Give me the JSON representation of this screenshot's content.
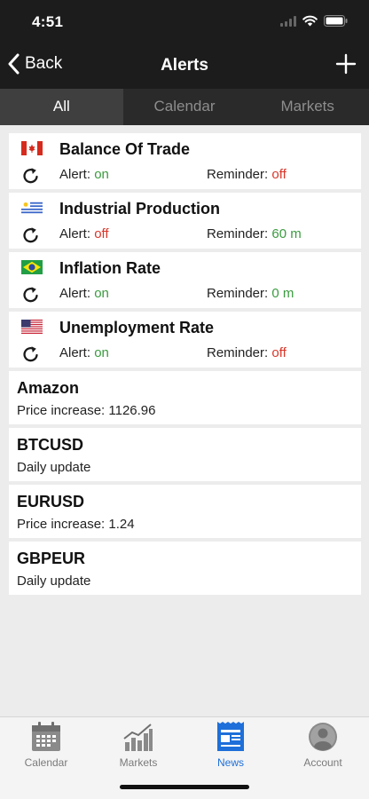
{
  "status_bar": {
    "time": "4:51",
    "icons": [
      "signal-icon",
      "wifi-icon",
      "battery-icon"
    ]
  },
  "nav": {
    "back_label": "Back",
    "title": "Alerts",
    "add_icon": "plus-icon"
  },
  "segments": [
    {
      "label": "All",
      "active": true
    },
    {
      "label": "Calendar",
      "active": false
    },
    {
      "label": "Markets",
      "active": false
    }
  ],
  "event_alerts": [
    {
      "title": "Balance Of Trade",
      "flag": "canada-flag-icon",
      "alert_label": "Alert:",
      "alert_value": "on",
      "reminder_label": "Reminder:",
      "reminder_value": "off"
    },
    {
      "title": "Industrial Production",
      "flag": "uruguay-flag-icon",
      "alert_label": "Alert:",
      "alert_value": "off",
      "reminder_label": "Reminder:",
      "reminder_value": "60 m"
    },
    {
      "title": "Inflation Rate",
      "flag": "brazil-flag-icon",
      "alert_label": "Alert:",
      "alert_value": "on",
      "reminder_label": "Reminder:",
      "reminder_value": "0 m"
    },
    {
      "title": "Unemployment Rate",
      "flag": "usa-flag-icon",
      "alert_label": "Alert:",
      "alert_value": "on",
      "reminder_label": "Reminder:",
      "reminder_value": "off"
    }
  ],
  "market_alerts": [
    {
      "title": "Amazon",
      "detail": "Price increase: 1126.96"
    },
    {
      "title": "BTCUSD",
      "detail": "Daily update"
    },
    {
      "title": "EURUSD",
      "detail": "Price increase: 1.24"
    },
    {
      "title": "GBPEUR",
      "detail": "Daily update"
    }
  ],
  "tab_bar": [
    {
      "label": "Calendar",
      "icon": "calendar-icon",
      "active": false
    },
    {
      "label": "Markets",
      "icon": "chart-icon",
      "active": false
    },
    {
      "label": "News",
      "icon": "news-icon",
      "active": true
    },
    {
      "label": "Account",
      "icon": "account-icon",
      "active": false
    }
  ],
  "colors": {
    "on": "#3a9b3e",
    "off": "#d9362a",
    "accent": "#1e6fd9",
    "bar_dark": "#1c1c1c"
  }
}
